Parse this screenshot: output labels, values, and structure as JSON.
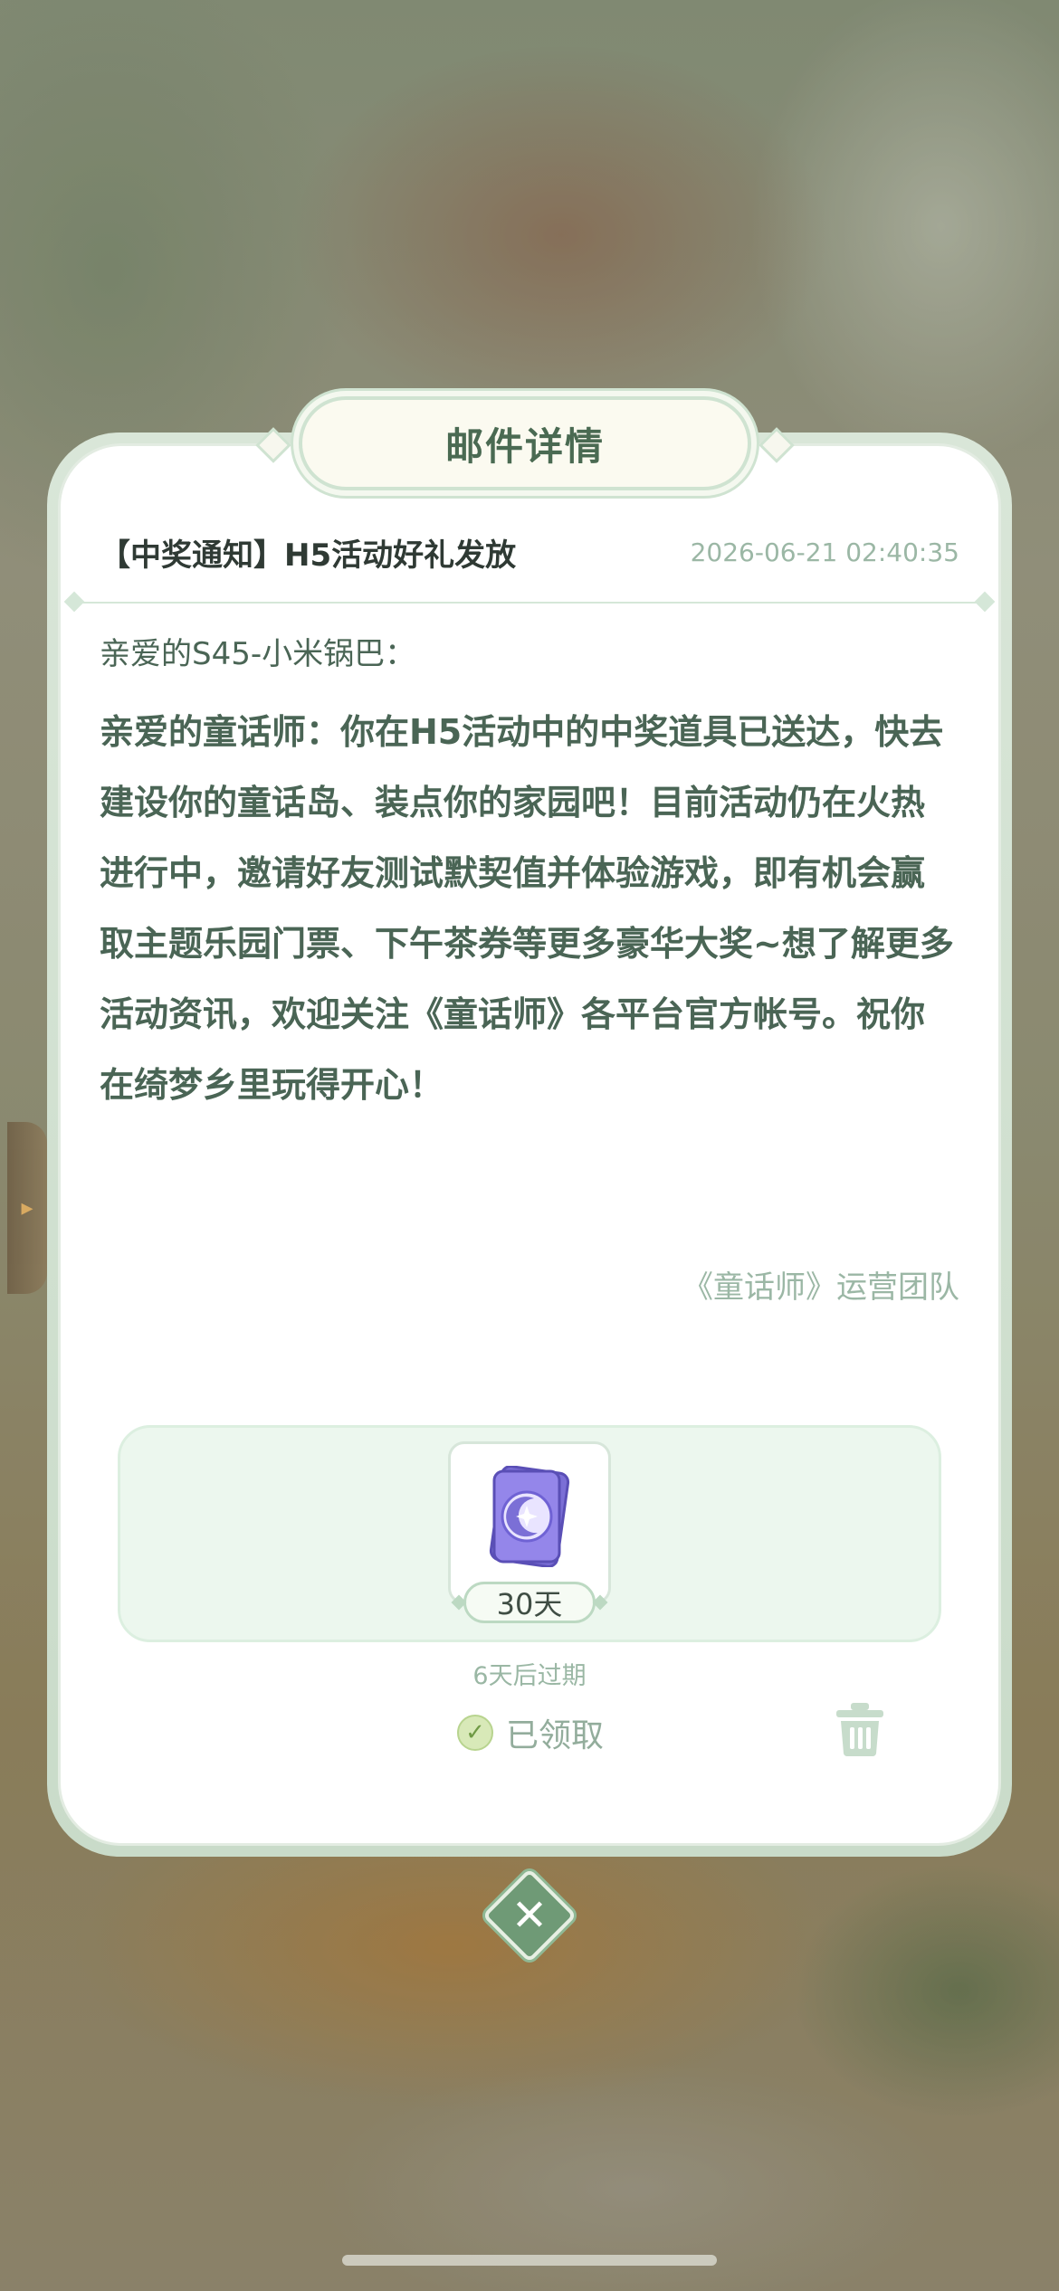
{
  "dialog": {
    "title": "邮件详情"
  },
  "mail": {
    "subject": "【中奖通知】H5活动好礼发放",
    "time": "2026-06-21 02:40:35",
    "greeting": "亲爱的S45-小米锅巴：",
    "body": "亲爱的童话师：你在H5活动中的中奖道具已送达，快去建设你的童话岛、装点你的家园吧！目前活动仍在火热进行中，邀请好友测试默契值并体验游戏，即有机会赢取主题乐园门票、下午茶券等更多豪华大奖~想了解更多活动资讯，欢迎关注《童话师》各平台官方帐号。祝你在绮梦乡里玩得开心！",
    "signature": "《童话师》运营团队"
  },
  "reward": {
    "item_icon": "moon-card-icon",
    "count_label": "30天",
    "expire_text": "6天后过期",
    "claimed_label": "已领取"
  },
  "icons": {
    "check": "check-circle-icon",
    "trash": "trash-icon",
    "close": "close-icon"
  },
  "colors": {
    "accent_green": "#6f9a76",
    "text_green": "#4a6555",
    "muted_green": "#9bb7a5",
    "reward_bg": "#ecf7ee"
  }
}
